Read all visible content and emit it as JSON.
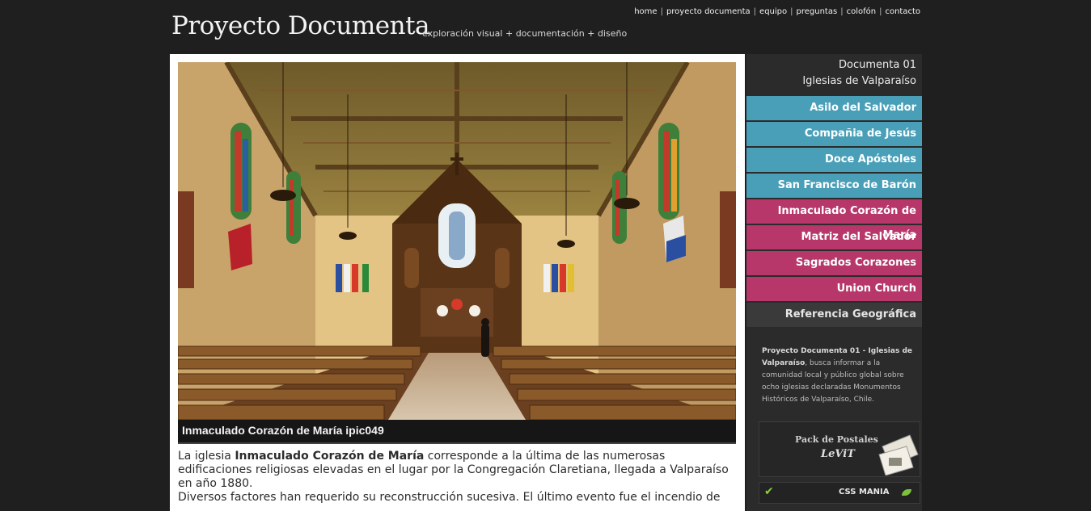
{
  "header": {
    "logo": "Proyecto Documenta",
    "tagline": "exploración visual + documentación + diseño",
    "nav": [
      "home",
      "proyecto documenta",
      "equipo",
      "preguntas",
      "colofón",
      "contacto"
    ]
  },
  "photo": {
    "caption": "Inmaculado Corazón de María ipic049"
  },
  "article": {
    "intro_before": "La iglesia ",
    "intro_bold": "Inmaculado Corazón de María",
    "intro_after": " corresponde a la última de las numerosas edificaciones religiosas elevadas en el lugar por la Congregación Claretiana, llegada a Valparaíso en año 1880.",
    "second": "Diversos factores han requerido su reconstrucción sucesiva. El último evento fue el incendio de"
  },
  "sidebar": {
    "heading_line1": "Documenta 01",
    "heading_line2": "Iglesias de Valparaíso",
    "items": [
      {
        "label": "Asilo del Salvador",
        "style": "blue"
      },
      {
        "label": "Compañia de Jesús",
        "style": "blue"
      },
      {
        "label": "Doce Apóstoles",
        "style": "blue"
      },
      {
        "label": "San Francisco de Barón",
        "style": "blue"
      },
      {
        "label": "Inmaculado Corazón de María",
        "style": "pink"
      },
      {
        "label": "Matriz del Salvador",
        "style": "pink"
      },
      {
        "label": "Sagrados Corazones",
        "style": "pink"
      },
      {
        "label": "Union Church",
        "style": "pink"
      },
      {
        "label": "Referencia Geográfica",
        "style": "dark"
      }
    ],
    "description_bold": "Proyecto Documenta 01 - Iglesias de Valparaíso",
    "description_rest": ", busca informar a la comunidad local y público global sobre ocho iglesias declaradas Monumentos Históricos de Valparaíso, Chile.",
    "promo_title": "Pack de Postales",
    "promo_brand": "LeViT",
    "badge_label": "CSS MANIA"
  },
  "colors": {
    "background": "#1f1f1f",
    "menu_blue": "#4a9fb8",
    "menu_pink": "#b8376a",
    "menu_dark": "#3a3a3a"
  }
}
